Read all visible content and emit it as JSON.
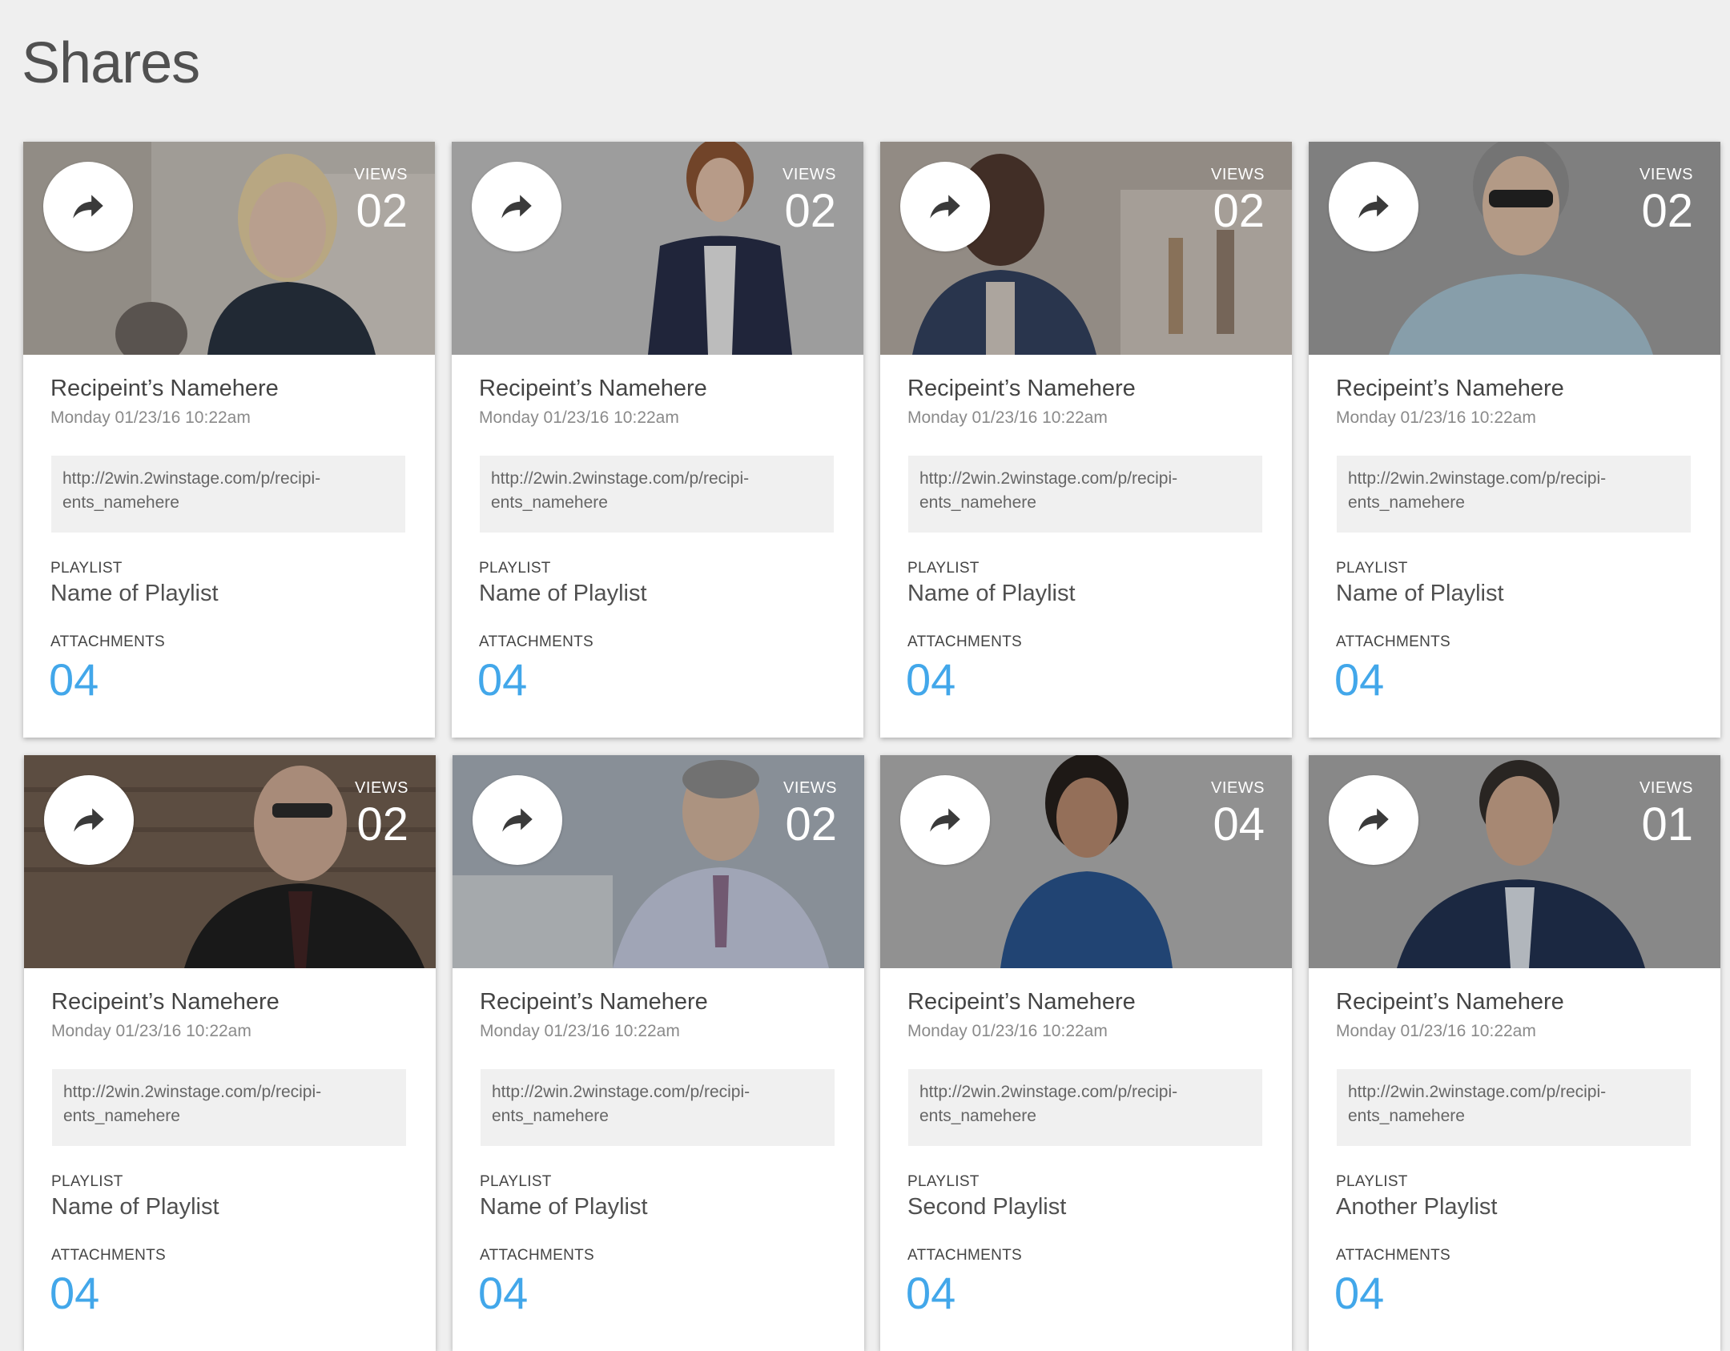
{
  "page": {
    "title": "Shares"
  },
  "labels": {
    "views": "VIEWS",
    "playlist": "PLAYLIST",
    "attachments": "ATTACHMENTS"
  },
  "icons": {
    "share": "share-arrow-icon"
  },
  "colors": {
    "accent": "#42a7ea",
    "background": "#efefef"
  },
  "shares": [
    {
      "recipient": "Recipeint’s Namehere",
      "date": "Monday 01/23/16 10:22am",
      "url": "http://2win.2winstage.com/p/recipi-\nents_namehere",
      "views": "02",
      "playlist": "Name of Playlist",
      "attachments": "04"
    },
    {
      "recipient": "Recipeint’s Namehere",
      "date": "Monday 01/23/16 10:22am",
      "url": "http://2win.2winstage.com/p/recipi-\nents_namehere",
      "views": "02",
      "playlist": "Name of Playlist",
      "attachments": "04"
    },
    {
      "recipient": "Recipeint’s Namehere",
      "date": "Monday 01/23/16 10:22am",
      "url": "http://2win.2winstage.com/p/recipi-\nents_namehere",
      "views": "02",
      "playlist": "Name of Playlist",
      "attachments": "04"
    },
    {
      "recipient": "Recipeint’s Namehere",
      "date": "Monday 01/23/16 10:22am",
      "url": "http://2win.2winstage.com/p/recipi-\nents_namehere",
      "views": "02",
      "playlist": "Name of Playlist",
      "attachments": "04"
    },
    {
      "recipient": "Recipeint’s Namehere",
      "date": "Monday 01/23/16 10:22am",
      "url": "http://2win.2winstage.com/p/recipi-\nents_namehere",
      "views": "02",
      "playlist": "Name of Playlist",
      "attachments": "04"
    },
    {
      "recipient": "Recipeint’s Namehere",
      "date": "Monday 01/23/16 10:22am",
      "url": "http://2win.2winstage.com/p/recipi-\nents_namehere",
      "views": "02",
      "playlist": "Name of Playlist",
      "attachments": "04"
    },
    {
      "recipient": "Recipeint’s Namehere",
      "date": "Monday 01/23/16 10:22am",
      "url": "http://2win.2winstage.com/p/recipi-\nents_namehere",
      "views": "04",
      "playlist": "Second Playlist",
      "attachments": "04"
    },
    {
      "recipient": "Recipeint’s Namehere",
      "date": "Monday 01/23/16 10:22am",
      "url": "http://2win.2winstage.com/p/recipi-\nents_namehere",
      "views": "01",
      "playlist": "Another Playlist",
      "attachments": "04"
    }
  ]
}
